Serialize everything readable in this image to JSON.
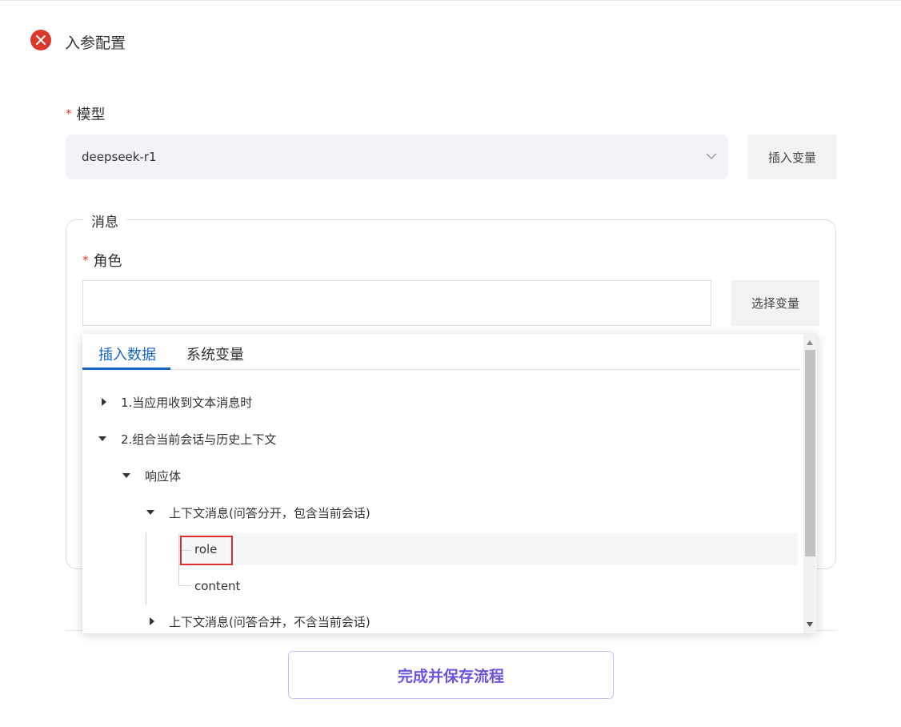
{
  "header": {
    "title": "入参配置",
    "close_icon": "close-icon",
    "accent_color": "#d8392c"
  },
  "model": {
    "required_mark": "*",
    "label": "模型",
    "selected_value": "deepseek-r1",
    "insert_variable_label": "插入变量"
  },
  "messages": {
    "legend": "消息",
    "role": {
      "required_mark": "*",
      "label": "角色",
      "value": "",
      "select_variable_label": "选择变量"
    }
  },
  "popover": {
    "tabs": [
      {
        "label": "插入数据",
        "active": true
      },
      {
        "label": "系统变量",
        "active": false
      }
    ],
    "tree": [
      {
        "label": "1.当应用收到文本消息时",
        "expanded": false
      },
      {
        "label": "2.组合当前会话与历史上下文",
        "expanded": true
      },
      {
        "label": "响应体",
        "expanded": true
      },
      {
        "label": "上下文消息(问答分开，包含当前会话)",
        "expanded": true
      },
      {
        "label": "role",
        "selected": true
      },
      {
        "label": "content"
      },
      {
        "label": "上下文消息(问答合并，不含当前会话)",
        "expanded": false
      }
    ],
    "accent_color": "#1665c0"
  },
  "footer": {
    "save_label": "完成并保存流程",
    "save_color": "#6c52e0"
  }
}
